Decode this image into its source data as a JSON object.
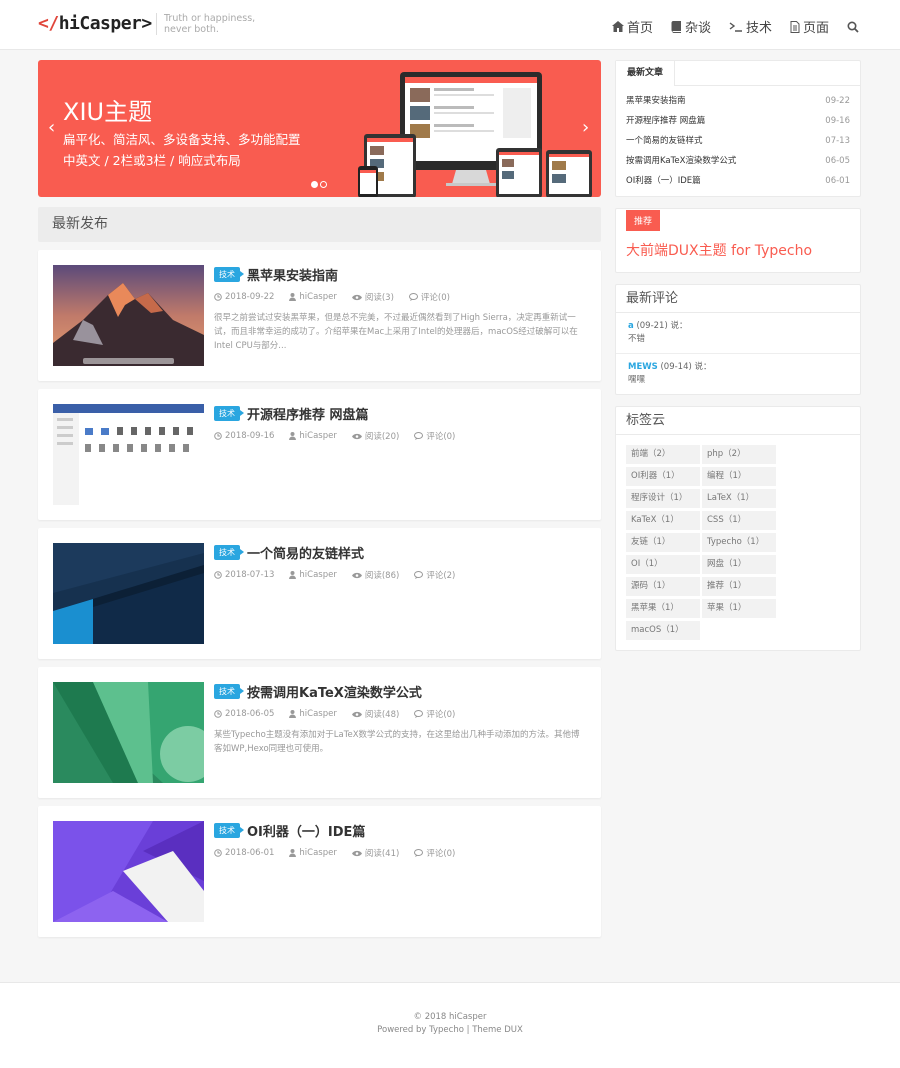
{
  "header": {
    "logo_prefix": "</",
    "logo_text": "hiCasper>",
    "tagline1": "Truth or happiness,",
    "tagline2": "never both.",
    "nav": [
      "首页",
      "杂谈",
      "技术",
      "页面"
    ]
  },
  "slider": {
    "title": "XIU主题",
    "line1": "扁平化、简洁风、多设备支持、多功能配置",
    "line2": "中英文 / 2栏或3栏 / 响应式布局",
    "prev": "‹",
    "next": "›",
    "bg_color": "#f95c50"
  },
  "main": {
    "section_title": "最新发布",
    "posts": [
      {
        "tag": "技术",
        "title": "黑苹果安装指南",
        "date": "2018-09-22",
        "author": "hiCasper",
        "views": "阅读(3)",
        "comments": "评论(0)",
        "excerpt": "很早之前尝试过安装黑苹果，但是总不完美，不过最近偶然看到了High Sierra，决定再重新试一试，而且非常幸运的成功了。介绍苹果在Mac上采用了Intel的处理器后，macOS经过破解可以在Intel CPU与部分..."
      },
      {
        "tag": "技术",
        "title": "开源程序推荐 网盘篇",
        "date": "2018-09-16",
        "author": "hiCasper",
        "views": "阅读(20)",
        "comments": "评论(0)",
        "excerpt": ""
      },
      {
        "tag": "技术",
        "title": "一个简易的友链样式",
        "date": "2018-07-13",
        "author": "hiCasper",
        "views": "阅读(86)",
        "comments": "评论(2)",
        "excerpt": ""
      },
      {
        "tag": "技术",
        "title": "按需调用KaTeX渲染数学公式",
        "date": "2018-06-05",
        "author": "hiCasper",
        "views": "阅读(48)",
        "comments": "评论(0)",
        "excerpt": "某些Typecho主题没有添加对于LaTeX数学公式的支持，在这里给出几种手动添加的方法。其他博客如WP,Hexo同理也可使用。"
      },
      {
        "tag": "技术",
        "title": "OI利器（一）IDE篇",
        "date": "2018-06-01",
        "author": "hiCasper",
        "views": "阅读(41)",
        "comments": "评论(0)",
        "excerpt": ""
      }
    ]
  },
  "sidebar": {
    "recent_tab": "最新文章",
    "recent": [
      {
        "title": "黑苹果安装指南",
        "date": "09-22"
      },
      {
        "title": "开源程序推荐 网盘篇",
        "date": "09-16"
      },
      {
        "title": "一个简易的友链样式",
        "date": "07-13"
      },
      {
        "title": "按需调用KaTeX渲染数学公式",
        "date": "06-05"
      },
      {
        "title": "OI利器（一）IDE篇",
        "date": "06-01"
      }
    ],
    "promo_badge": "推荐",
    "promo_text": "大前端DUX主题 for Typecho",
    "comments_title": "最新评论",
    "comments": [
      {
        "who": "a",
        "meta": " (09-21) 说：",
        "text": "不错"
      },
      {
        "who": "MEWS",
        "meta": " (09-14) 说：",
        "text": "嘿嘿"
      }
    ],
    "tags_title": "标签云",
    "tags": [
      "前端（2）",
      "php（2）",
      "OI利器（1）",
      "编程（1）",
      "程序设计（1）",
      "LaTeX（1）",
      "KaTeX（1）",
      "CSS（1）",
      "友链（1）",
      "Typecho（1）",
      "OI（1）",
      "网盘（1）",
      "源码（1）",
      "推荐（1）",
      "黑苹果（1）",
      "苹果（1）",
      "macOS（1）"
    ]
  },
  "footer": {
    "copyright": "© 2018 hiCasper",
    "powered": "Powered by Typecho | Theme DUX"
  },
  "colors": {
    "accent": "#f95c50",
    "tag": "#2aa6e0"
  }
}
